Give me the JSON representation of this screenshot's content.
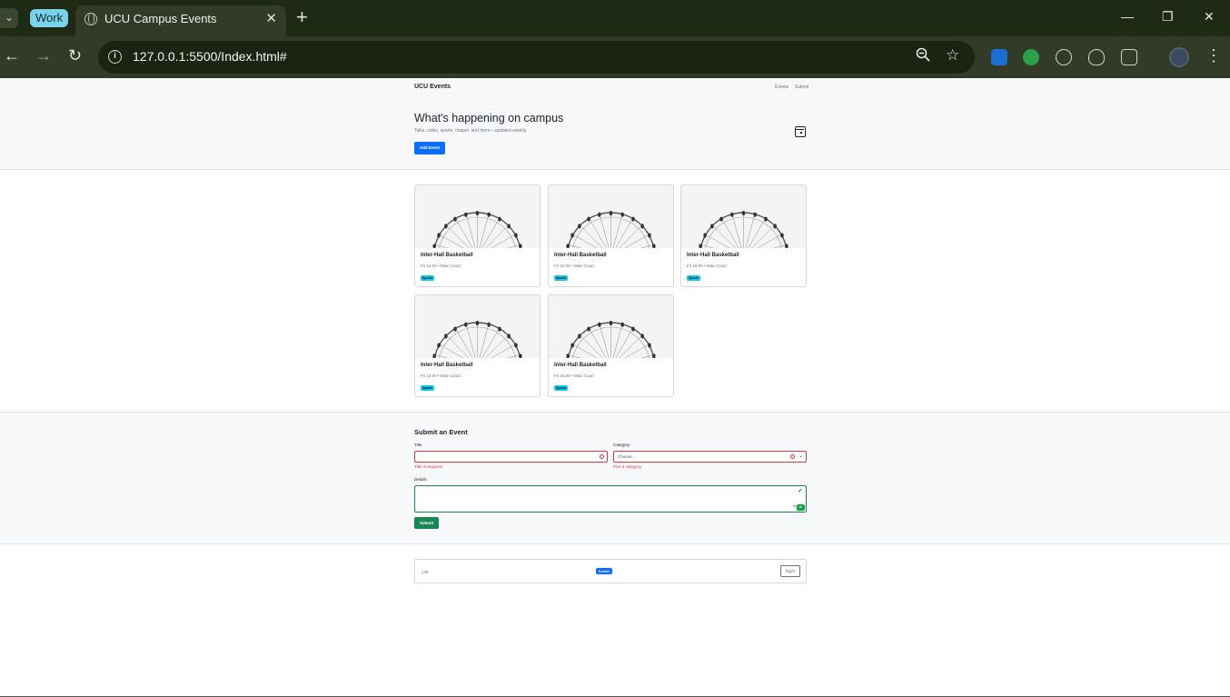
{
  "browser": {
    "group_label": "Work",
    "tab_title": "UCU Campus Events",
    "new_tab_glyph": "+",
    "close_glyph": "✕",
    "url": "127.0.0.1:5500/Index.html#",
    "icons": [
      "tab-search-icon",
      "globe-icon",
      "back-icon",
      "forward-icon",
      "reload-icon",
      "info-icon",
      "zoom-out-icon",
      "bookmark-star-icon",
      "extension-icon",
      "extensions-puzzle-icon",
      "profile-avatar",
      "menu-kebab-icon"
    ]
  },
  "site": {
    "brand": "UCU Events",
    "nav": [
      "Events",
      "Submit"
    ]
  },
  "hero": {
    "title": "What's happening on campus",
    "subtitle": "Talks, clubs, sports, chapel, and more—updated weekly.",
    "add_button": "Add Event"
  },
  "events": [
    {
      "title": "Inter-Hall Basketball",
      "meta": "Fri 16:00 • Main Court",
      "badge": "Sports"
    },
    {
      "title": "Inter-Hall Basketball",
      "meta": "Fri 16:00 • Main Court",
      "badge": "Sports"
    },
    {
      "title": "Inter-Hall Basketball",
      "meta": "Fri 16:00 • Main Court",
      "badge": "Sports"
    },
    {
      "title": "Inter-Hall Basketball",
      "meta": "Fri 16:00 • Main Court",
      "badge": "Sports"
    },
    {
      "title": "Inter-Hall Basketball",
      "meta": "Fri 16:00 • Main Court",
      "badge": "Sports"
    }
  ],
  "form": {
    "heading": "Submit an Event",
    "title_label": "Title",
    "title_value": "",
    "title_error": "Title is required.",
    "category_label": "Category",
    "category_placeholder": "Choose...",
    "category_error": "Pick a category.",
    "details_label": "Details",
    "details_value": "",
    "submit": "Submit"
  },
  "alignment": {
    "left": "Left",
    "center": "Center",
    "right": "Right"
  },
  "colors": {
    "primary": "#0d6efd",
    "success": "#198754",
    "danger": "#dc3545",
    "info": "#0dcaf0",
    "browser_frame": "#1f2a15"
  }
}
